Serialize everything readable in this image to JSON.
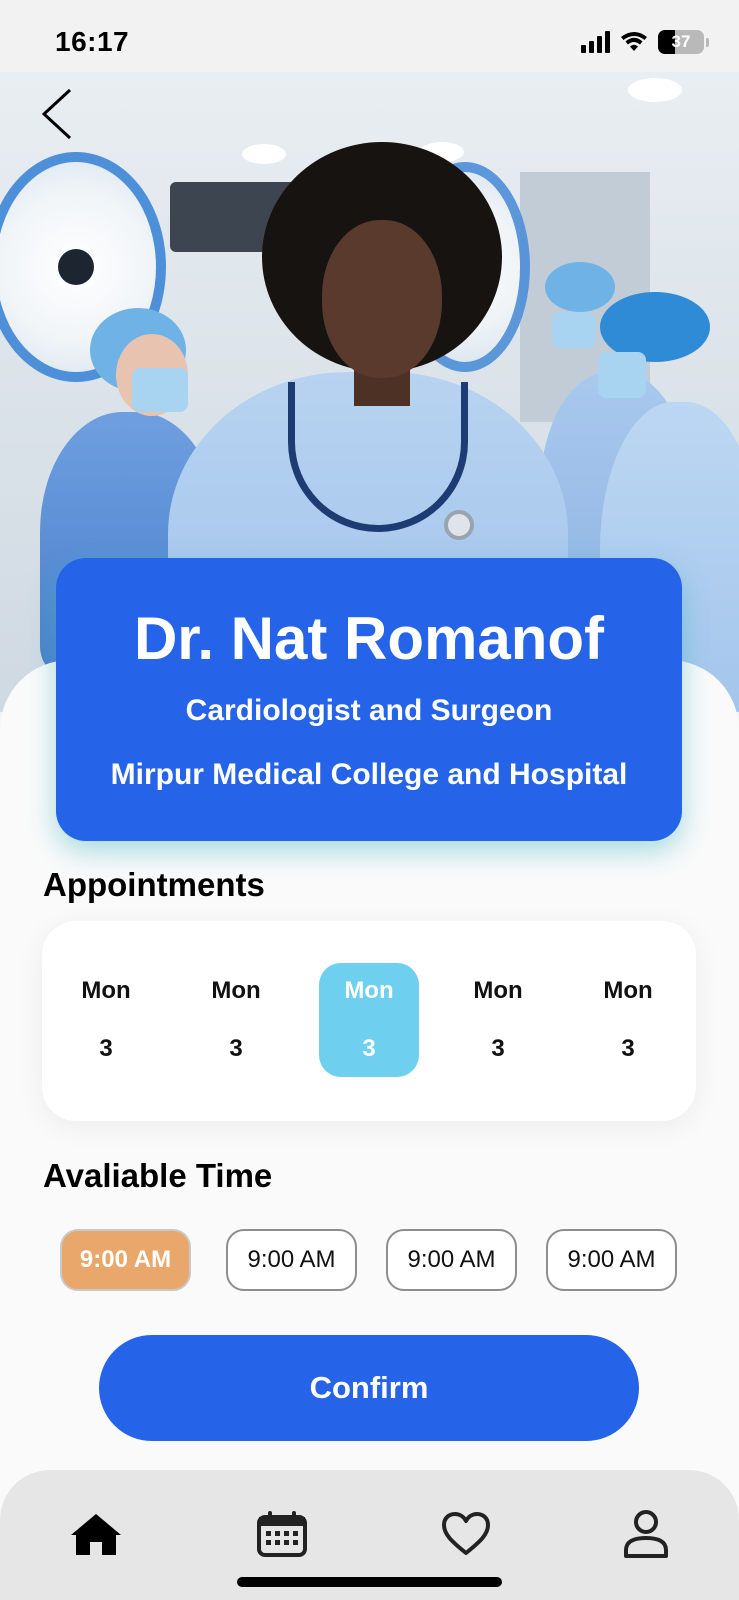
{
  "status_bar": {
    "time": "16:17",
    "battery": "37"
  },
  "doctor": {
    "name": "Dr. Nat Romanof",
    "specialty": "Cardiologist and Surgeon",
    "hospital": "Mirpur Medical College and Hospital"
  },
  "appointments": {
    "title": "Appointments",
    "dates": [
      {
        "day": "Mon",
        "num": "3",
        "selected": false
      },
      {
        "day": "Mon",
        "num": "3",
        "selected": false
      },
      {
        "day": "Mon",
        "num": "3",
        "selected": true
      },
      {
        "day": "Mon",
        "num": "3",
        "selected": false
      },
      {
        "day": "Mon",
        "num": "3",
        "selected": false
      }
    ]
  },
  "available_time": {
    "title": "Avaliable Time",
    "slots": [
      {
        "label": "9:00 AM",
        "selected": true
      },
      {
        "label": "9:00 AM",
        "selected": false
      },
      {
        "label": "9:00 AM",
        "selected": false
      },
      {
        "label": "9:00 AM",
        "selected": false
      }
    ]
  },
  "confirm_label": "Confirm",
  "tab_bar": {
    "items": [
      "home-icon",
      "calendar-icon",
      "heart-icon",
      "profile-icon"
    ]
  },
  "colors": {
    "primary": "#2563e8",
    "date_selected": "#6fcfee",
    "time_selected": "#e9a76b"
  }
}
